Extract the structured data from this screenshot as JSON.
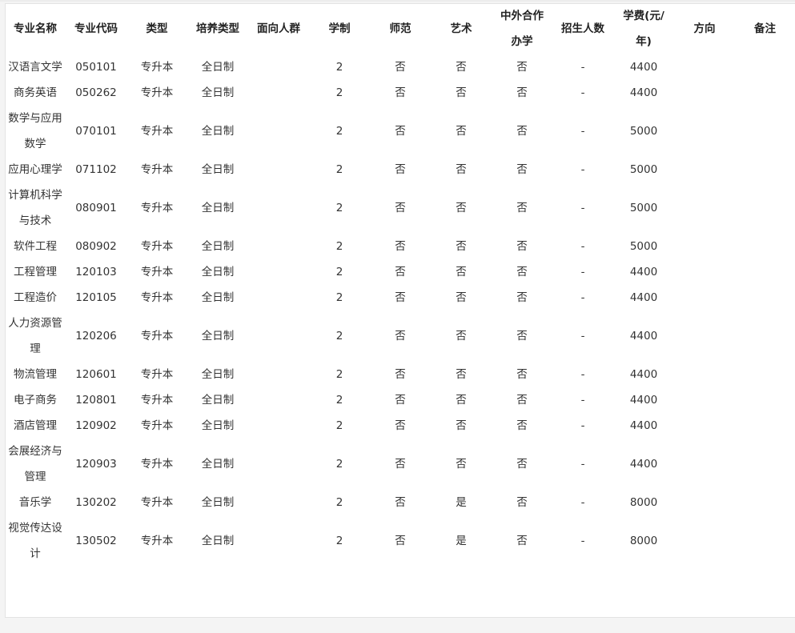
{
  "table": {
    "headers": [
      "专业名称",
      "专业代码",
      "类型",
      "培养类型",
      "面向人群",
      "学制",
      "师范",
      "艺术",
      "中外合作办学",
      "招生人数",
      "学费(元/年)",
      "方向",
      "备注"
    ],
    "rows": [
      [
        "汉语言文学",
        "050101",
        "专升本",
        "全日制",
        "",
        "2",
        "否",
        "否",
        "否",
        "-",
        "4400",
        "",
        ""
      ],
      [
        "商务英语",
        "050262",
        "专升本",
        "全日制",
        "",
        "2",
        "否",
        "否",
        "否",
        "-",
        "4400",
        "",
        ""
      ],
      [
        "数学与应用数学",
        "070101",
        "专升本",
        "全日制",
        "",
        "2",
        "否",
        "否",
        "否",
        "-",
        "5000",
        "",
        ""
      ],
      [
        "应用心理学",
        "071102",
        "专升本",
        "全日制",
        "",
        "2",
        "否",
        "否",
        "否",
        "-",
        "5000",
        "",
        ""
      ],
      [
        "计算机科学与技术",
        "080901",
        "专升本",
        "全日制",
        "",
        "2",
        "否",
        "否",
        "否",
        "-",
        "5000",
        "",
        ""
      ],
      [
        "软件工程",
        "080902",
        "专升本",
        "全日制",
        "",
        "2",
        "否",
        "否",
        "否",
        "-",
        "5000",
        "",
        ""
      ],
      [
        "工程管理",
        "120103",
        "专升本",
        "全日制",
        "",
        "2",
        "否",
        "否",
        "否",
        "-",
        "4400",
        "",
        ""
      ],
      [
        "工程造价",
        "120105",
        "专升本",
        "全日制",
        "",
        "2",
        "否",
        "否",
        "否",
        "-",
        "4400",
        "",
        ""
      ],
      [
        "人力资源管理",
        "120206",
        "专升本",
        "全日制",
        "",
        "2",
        "否",
        "否",
        "否",
        "-",
        "4400",
        "",
        ""
      ],
      [
        "物流管理",
        "120601",
        "专升本",
        "全日制",
        "",
        "2",
        "否",
        "否",
        "否",
        "-",
        "4400",
        "",
        ""
      ],
      [
        "电子商务",
        "120801",
        "专升本",
        "全日制",
        "",
        "2",
        "否",
        "否",
        "否",
        "-",
        "4400",
        "",
        ""
      ],
      [
        "酒店管理",
        "120902",
        "专升本",
        "全日制",
        "",
        "2",
        "否",
        "否",
        "否",
        "-",
        "4400",
        "",
        ""
      ],
      [
        "会展经济与管理",
        "120903",
        "专升本",
        "全日制",
        "",
        "2",
        "否",
        "否",
        "否",
        "-",
        "4400",
        "",
        ""
      ],
      [
        "音乐学",
        "130202",
        "专升本",
        "全日制",
        "",
        "2",
        "否",
        "是",
        "否",
        "-",
        "8000",
        "",
        ""
      ],
      [
        "视觉传达设计",
        "130502",
        "专升本",
        "全日制",
        "",
        "2",
        "否",
        "是",
        "否",
        "-",
        "8000",
        "",
        ""
      ]
    ]
  }
}
